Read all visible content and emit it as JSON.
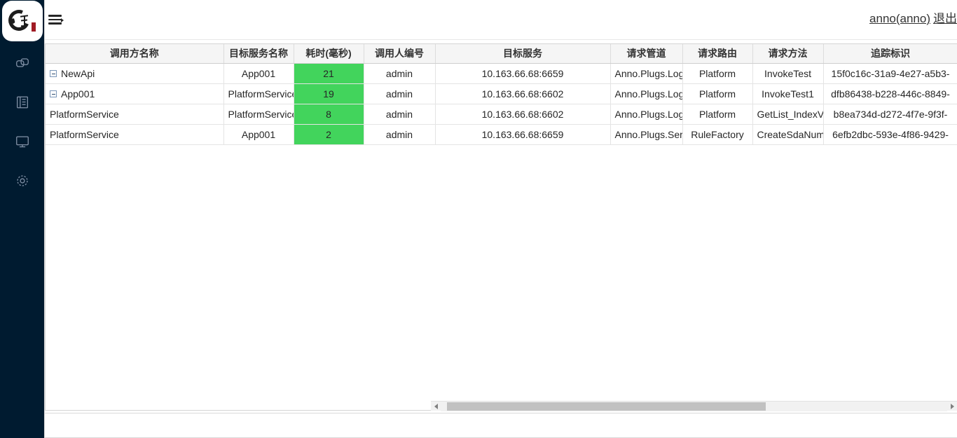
{
  "app": {
    "logo_alt": "app-logo"
  },
  "sidebar": {
    "items": [
      {
        "icon": "link-chain-icon",
        "name": "sidebar-item-links"
      },
      {
        "icon": "document-icon",
        "name": "sidebar-item-logs"
      },
      {
        "icon": "monitor-icon",
        "name": "sidebar-item-monitor"
      },
      {
        "icon": "gear-icon",
        "name": "sidebar-item-settings"
      }
    ]
  },
  "topbar": {
    "menu_toggle_label": "menu-toggle",
    "user_label": "anno(anno)",
    "logout_label": "退出"
  },
  "table": {
    "columns": [
      "调用方名称",
      "目标服务名称",
      "耗时(毫秒)",
      "调用人编号",
      "目标服务",
      "请求管道",
      "请求路由",
      "请求方法",
      "追踪标识"
    ],
    "rows": [
      {
        "caller": "NewApi",
        "indent": 0,
        "expandable": true,
        "target_service_name": "App001",
        "duration": "21",
        "operator": "admin",
        "target_service": "10.163.66.68:6659",
        "pipeline": "Anno.Plugs.Logi",
        "route": "Platform",
        "method": "InvokeTest",
        "trace_id": "15f0c16c-31a9-4e27-a5b3-"
      },
      {
        "caller": "App001",
        "indent": 1,
        "expandable": true,
        "target_service_name": "PlatformService",
        "duration": "19",
        "operator": "admin",
        "target_service": "10.163.66.68:6602",
        "pipeline": "Anno.Plugs.Logi",
        "route": "Platform",
        "method": "InvokeTest1",
        "trace_id": "dfb86438-b228-446c-8849-"
      },
      {
        "caller": "PlatformService",
        "indent": 2,
        "expandable": false,
        "target_service_name": "PlatformService",
        "duration": "8",
        "operator": "admin",
        "target_service": "10.163.66.68:6602",
        "pipeline": "Anno.Plugs.Logi",
        "route": "Platform",
        "method": "GetList_IndexVie",
        "trace_id": "b8ea734d-d272-4f7e-9f3f-"
      },
      {
        "caller": "PlatformService",
        "indent": 2,
        "expandable": false,
        "target_service_name": "App001",
        "duration": "2",
        "operator": "admin",
        "target_service": "10.163.66.68:6659",
        "pipeline": "Anno.Plugs.Seri",
        "route": "RuleFactory",
        "method": "CreateSdaNum",
        "trace_id": "6efb2dbc-593e-4f86-9429-"
      }
    ]
  },
  "colors": {
    "sidebar_bg": "#001b30",
    "duration_cell": "#42d45c",
    "header_bg": "#f5f5f5",
    "scrollbar_thumb": "#c1c1c1"
  }
}
